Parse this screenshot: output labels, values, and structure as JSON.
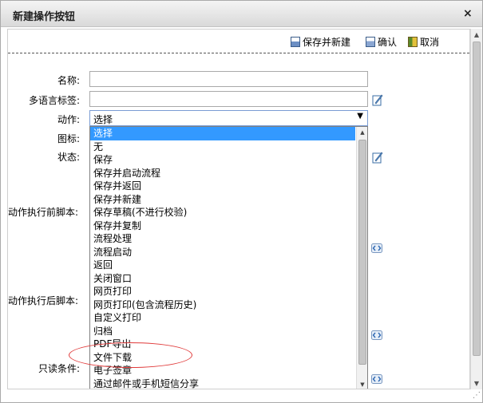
{
  "dialog": {
    "title": "新建操作按钮",
    "close_glyph": "×"
  },
  "toolbar": {
    "save_new_label": "保存并新建",
    "confirm_label": "确认",
    "cancel_label": "取消"
  },
  "form": {
    "name_label": "名称:",
    "name_value": "",
    "i18n_label": "多语言标签:",
    "i18n_value": "",
    "action_label": "动作:",
    "action_value": "选择",
    "icon_label": "图标:",
    "status_label": "状态:",
    "before_script_label": "动作执行前脚本:",
    "after_script_label": "动作执行后脚本:",
    "readonly_label": "只读条件:"
  },
  "action_options": [
    "选择",
    "无",
    "保存",
    "保存并启动流程",
    "保存并返回",
    "保存并新建",
    "保存草稿(不进行校验)",
    "保存并复制",
    "流程处理",
    "流程启动",
    "返回",
    "关闭窗口",
    "网页打印",
    "网页打印(包含流程历史)",
    "自定义打印",
    "归档",
    "PDF导出",
    "文件下载",
    "电子签章",
    "通过邮件或手机短信分享"
  ],
  "selected_option_index": 0,
  "annotation": {
    "highlighted_options": [
      "自定义打印",
      "归档"
    ],
    "color": "#e03a3a"
  },
  "colors": {
    "selection": "#3399ff",
    "select_border": "#7a9cd3"
  }
}
